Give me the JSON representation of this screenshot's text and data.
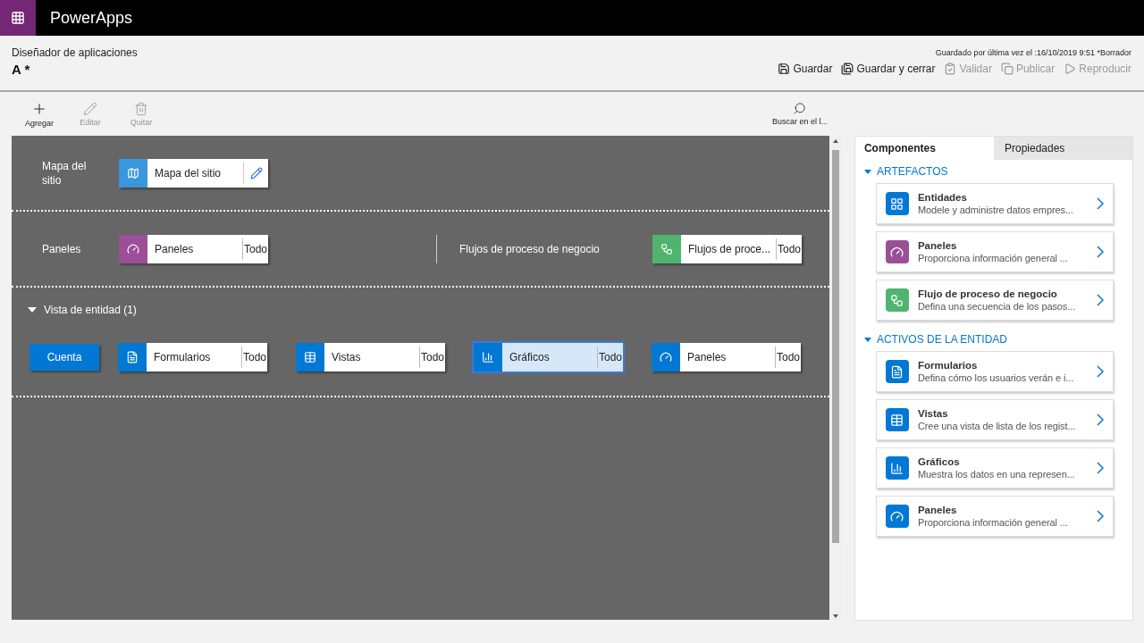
{
  "app_bar": {
    "title": "PowerApps"
  },
  "header": {
    "subtitle": "Diseñador de aplicaciones",
    "title": "A *",
    "saved_status": "Guardado por última vez el :16/10/2019 9:51 *Borrador",
    "actions": [
      {
        "label": "Guardar",
        "disabled": false
      },
      {
        "label": "Guardar y cerrar",
        "disabled": false
      },
      {
        "label": "Validar",
        "disabled": true
      },
      {
        "label": "Publicar",
        "disabled": true
      },
      {
        "label": "Reproducir",
        "disabled": true
      }
    ]
  },
  "toolbar": {
    "tools": [
      {
        "label": "Agregar",
        "disabled": false
      },
      {
        "label": "Editar",
        "disabled": true
      },
      {
        "label": "Quitar",
        "disabled": true
      }
    ],
    "search": {
      "label": "Buscar en el l..."
    }
  },
  "canvas": {
    "site_map": {
      "label": "Mapa del sitio",
      "tile": {
        "name": "Mapa del sitio",
        "kind": "map",
        "color": "#3a96dd",
        "selected": false
      }
    },
    "dashboards": {
      "label": "Paneles",
      "tile": {
        "name": "Paneles",
        "link": "Todo",
        "kind": "dashboard",
        "color": "#9b4f96",
        "selected": false
      }
    },
    "flows": {
      "label": "Flujos de proceso de negocio",
      "tile": {
        "name": "Flujos de proce...",
        "link": "Todo",
        "kind": "flow",
        "color": "#4fb46e",
        "selected": false
      }
    },
    "entity_view": {
      "title": "Vista de entidad (1)",
      "expanded": true,
      "entity": "Cuenta",
      "tiles": [
        {
          "name": "Formularios",
          "link": "Todo",
          "kind": "form",
          "color": "#0078d4",
          "selected": false
        },
        {
          "name": "Vistas",
          "link": "Todo",
          "kind": "view",
          "color": "#0078d4",
          "selected": false
        },
        {
          "name": "Gráficos",
          "link": "Todo",
          "kind": "chart",
          "color": "#0078d4",
          "selected": true
        },
        {
          "name": "Paneles",
          "link": "Todo",
          "kind": "dashboard",
          "color": "#0078d4",
          "selected": false
        }
      ]
    }
  },
  "side_panel": {
    "tabs": [
      {
        "label": "Componentes",
        "selected": true
      },
      {
        "label": "Propiedades",
        "selected": false
      }
    ],
    "groups": [
      {
        "title": "ARTEFACTOS",
        "expanded": true,
        "items": [
          {
            "title": "Entidades",
            "description": "Modele y administre datos empres...",
            "kind": "entity",
            "color": "#0078d4"
          },
          {
            "title": "Paneles",
            "description": "Proporciona información general ...",
            "kind": "dashboard",
            "color": "#9b4f96"
          },
          {
            "title": "Flujo de proceso de negocio",
            "description": "Defina una secuencia de los pasos...",
            "kind": "flow",
            "color": "#4fb46e"
          }
        ]
      },
      {
        "title": "ACTIVOS DE LA ENTIDAD",
        "expanded": true,
        "items": [
          {
            "title": "Formularios",
            "description": "Defina cómo los usuarios verán e i...",
            "kind": "form",
            "color": "#0078d4"
          },
          {
            "title": "Vistas",
            "description": "Cree una vista de lista de los regist...",
            "kind": "view",
            "color": "#0078d4"
          },
          {
            "title": "Gráficos",
            "description": "Muestra los datos en una represen...",
            "kind": "chart",
            "color": "#0078d4"
          },
          {
            "title": "Paneles",
            "description": "Proporciona información general ...",
            "kind": "dashboard",
            "color": "#0078d4"
          }
        ]
      }
    ]
  }
}
